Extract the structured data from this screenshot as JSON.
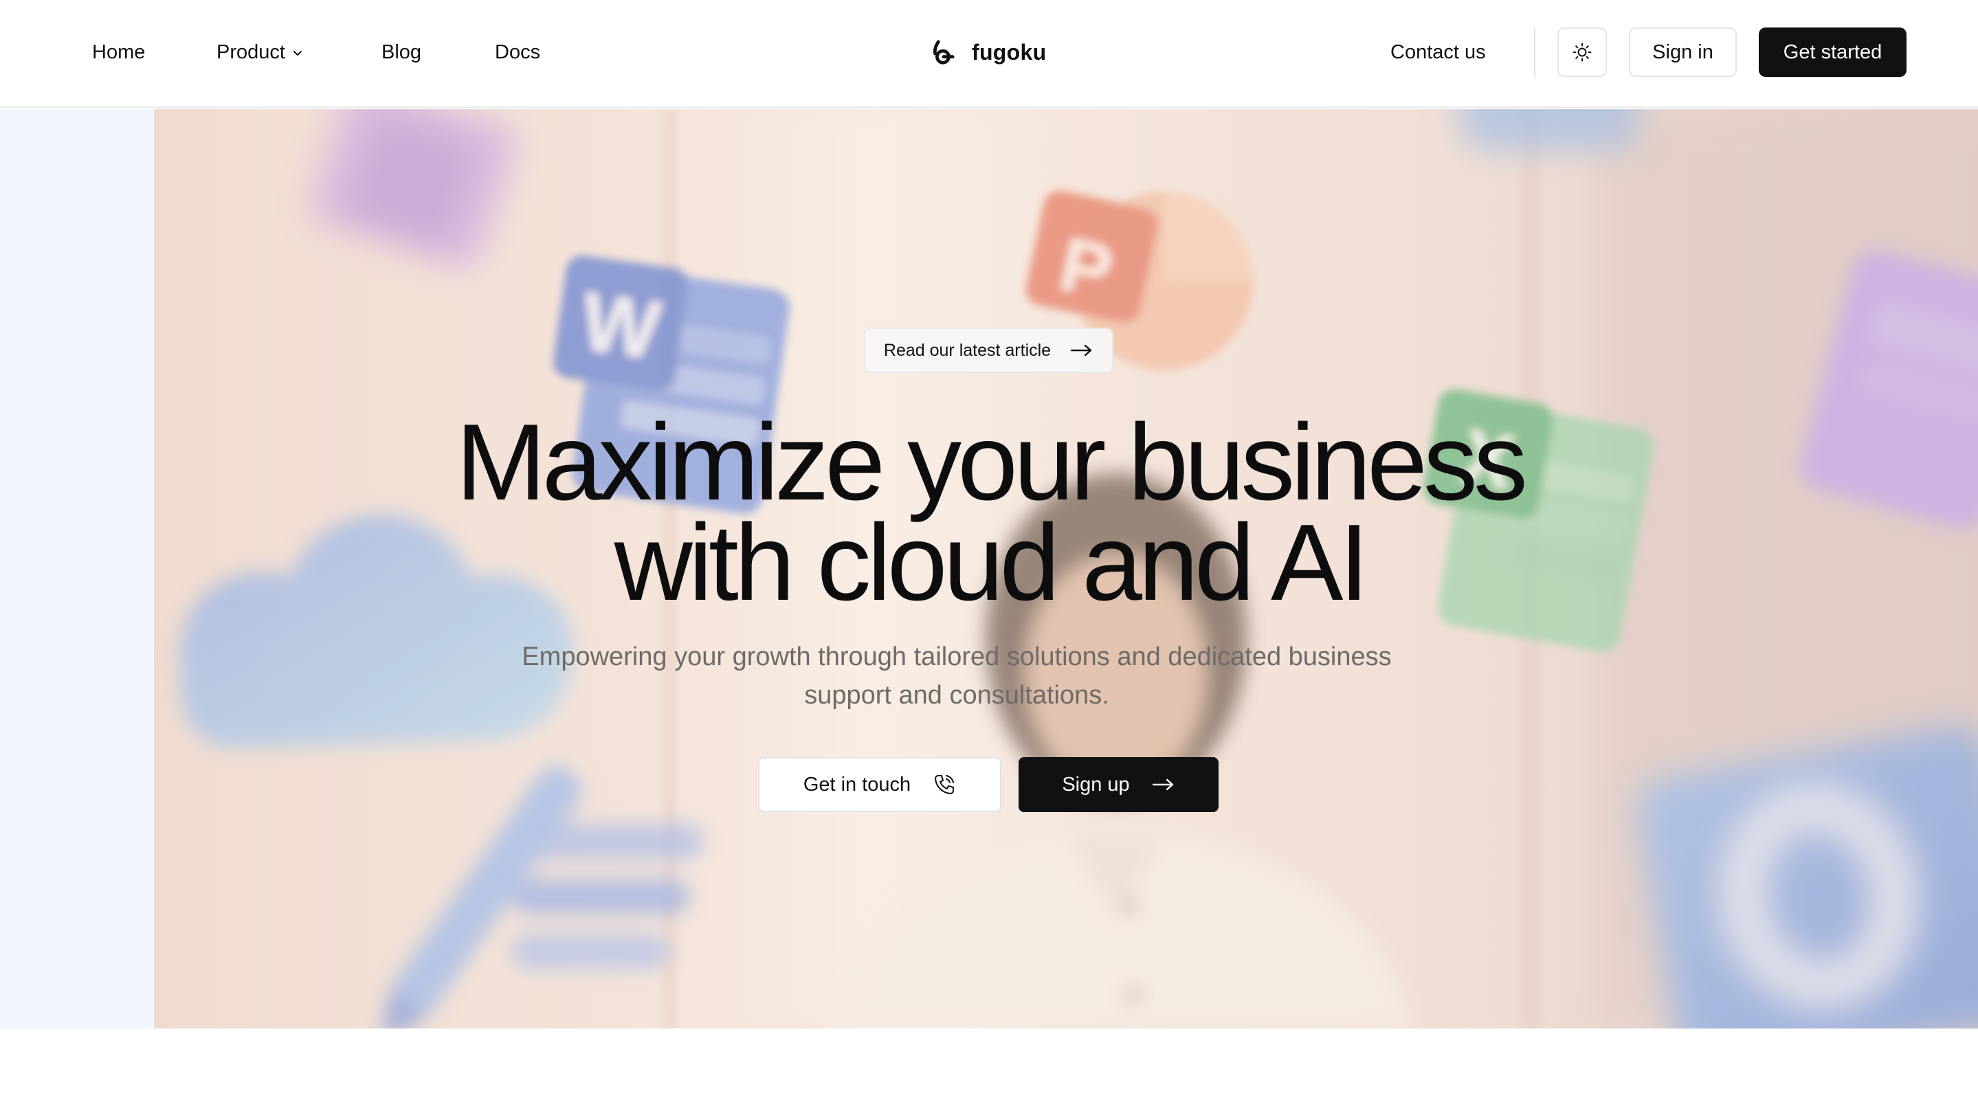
{
  "nav": {
    "home": "Home",
    "product": "Product",
    "blog": "Blog",
    "docs": "Docs",
    "brand": "fugoku",
    "contact": "Contact us",
    "sign_in": "Sign in",
    "get_started": "Get started",
    "theme_icon": "sun-icon"
  },
  "hero": {
    "pill_label": "Read our latest article",
    "title_line1": "Maximize your business",
    "title_line2": "with cloud and AI",
    "subtitle_line1": "Empowering your growth through tailored solutions and dedicated business",
    "subtitle_line2": "support and consultations.",
    "get_in_touch": "Get in touch",
    "sign_up": "Sign up",
    "app_letters": {
      "word": "W",
      "powerpoint": "P",
      "excel": "X",
      "outlook": "O"
    }
  },
  "colors": {
    "primary": "#111111",
    "left_strip": "#f1f6fd",
    "subtitle": "#6e6a68"
  }
}
